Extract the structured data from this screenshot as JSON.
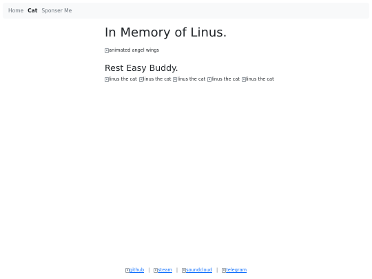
{
  "nav": {
    "items": [
      {
        "label": "Home",
        "active": false
      },
      {
        "label": "Cat",
        "active": true
      },
      {
        "label": "Sponser Me",
        "active": false
      }
    ]
  },
  "main": {
    "title": "In Memory of Linus.",
    "wings_alt": "animated angel wings",
    "subtitle": "Rest Easy Buddy.",
    "cat_images": [
      "linus the cat",
      "linus the cat",
      "linus the cat",
      "linus the cat",
      "linus the cat"
    ]
  },
  "footer": {
    "links": [
      "github",
      "steam",
      "soundcloud",
      "telegram"
    ],
    "separator": "|"
  },
  "colors": {
    "navbar_bg": "#f8f9fa",
    "link": "#0d6efd",
    "text": "#212529",
    "muted": "#6c757d"
  }
}
